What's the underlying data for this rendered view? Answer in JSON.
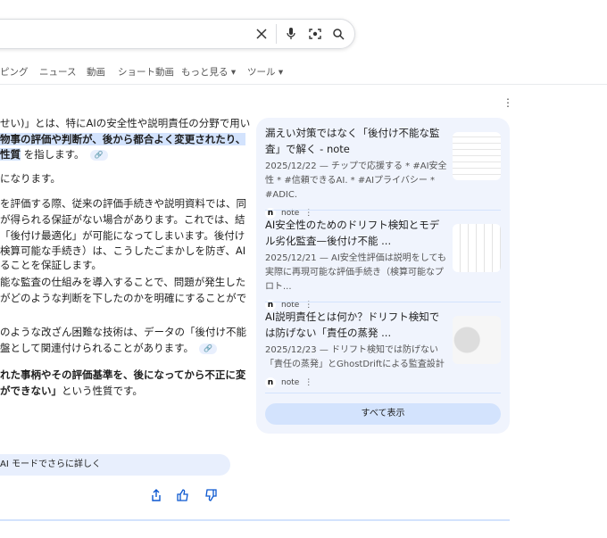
{
  "search": {
    "clear": "clear-icon",
    "voice": "mic-icon",
    "lens": "lens-icon",
    "search": "search-icon"
  },
  "tabs": [
    "ピング",
    "ニュース",
    "動画",
    "ショート動画",
    "もっと見る ▾",
    "ツール ▾"
  ],
  "answer": {
    "lines": [
      {
        "parts": [
          {
            "t": "せい)」とは、特にAIの安全性や説明責任の分野で用い"
          }
        ]
      },
      {
        "parts": [
          {
            "t": "物事の評価や判断が、後から都合よく変更されたり、",
            "b": true,
            "h": true
          }
        ]
      },
      {
        "parts": [
          {
            "t": "性質",
            "b": true,
            "h": true
          },
          {
            "t": " を指します。"
          }
        ],
        "chip": true
      },
      {
        "parts": [
          {
            "t": "になります。"
          }
        ]
      },
      {
        "parts": [
          {
            "t": "を評価する際、従来の評価手続きや説明資料では、同"
          }
        ]
      },
      {
        "parts": [
          {
            "t": "が得られる保証がない場合があります。これでは、結"
          }
        ]
      },
      {
        "parts": [
          {
            "t": "「後付け最適化」が可能になってしまいます。後付け"
          }
        ]
      },
      {
        "parts": [
          {
            "t": "検算可能な手続き）は、こうしたごまかしを防ぎ、AI"
          }
        ]
      },
      {
        "parts": [
          {
            "t": "ることを保証します。"
          }
        ]
      },
      {
        "parts": [
          {
            "t": "能な監査の仕組みを導入することで、問題が発生した"
          }
        ]
      },
      {
        "parts": [
          {
            "t": "がどのような判断を下したのかを明確にすることがで"
          }
        ]
      },
      {
        "parts": [
          {
            "t": "のような改ざん困難な技術は、データの「後付け不能"
          }
        ]
      },
      {
        "parts": [
          {
            "t": "盤として関連付けられることがあります。"
          }
        ],
        "chip": true
      },
      {
        "parts": [
          {
            "t": "れた事柄やその評価基準を、後になってから不正に変",
            "b": true
          }
        ]
      },
      {
        "parts": [
          {
            "t": "ができない」",
            "b": true
          },
          {
            "t": "という性質です。"
          }
        ]
      }
    ],
    "ai_mode": "AI モードでさらに詳しく"
  },
  "sources": {
    "items": [
      {
        "title": "漏えい対策ではなく「後付け不能な監査」で解く - note",
        "snippet": "2025/12/22 — チップで応援する * #AI安全性 * #信頼できるAI. * #AIプライバシー * #ADIC.",
        "source": "note"
      },
      {
        "title": "AI安全性のためのドリフト検知とモデル劣化監査—後付け不能 ...",
        "snippet": "2025/12/21 — AI安全性評価は説明をしても実際に再現可能な評価手続き（検算可能なプロト...",
        "source": "note"
      },
      {
        "title": "AI説明責任とは何か？ドリフト検知では防げない「責任の蒸発 ...",
        "snippet": "2025/12/23 — ドリフト検知では防げない「責任の蒸発」とGhostDriftによる監査設計",
        "source": "note"
      }
    ],
    "show_all": "すべて表示"
  }
}
